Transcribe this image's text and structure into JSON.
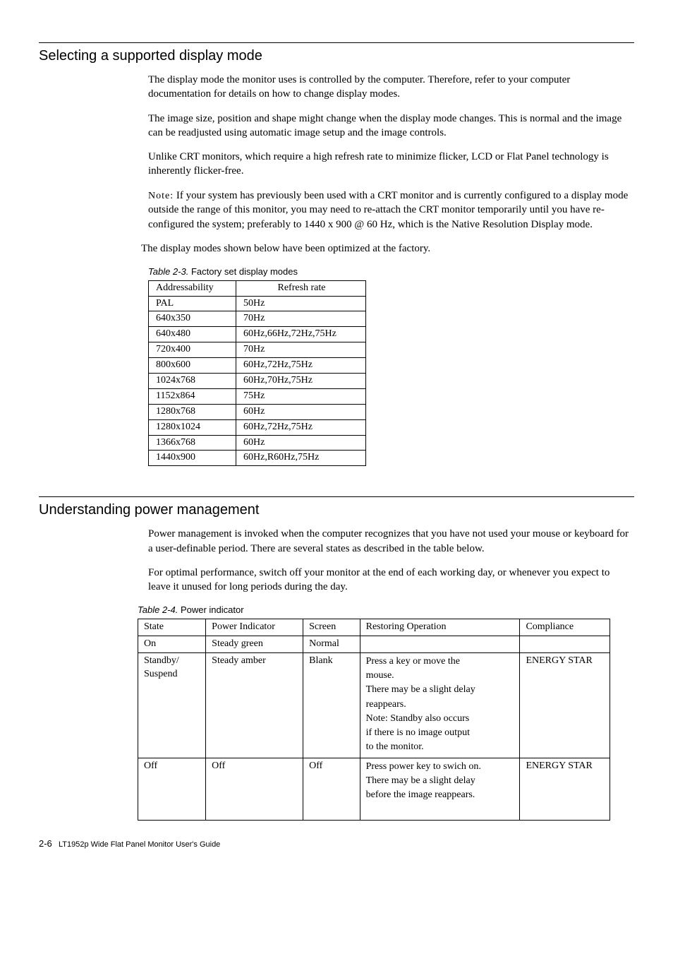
{
  "section1": {
    "heading": "Selecting a supported display mode",
    "p1": "The display mode the monitor uses is controlled by the computer. Therefore, refer to your computer documentation for details on how to change display modes.",
    "p2": "The image size, position and shape might change when the display mode changes. This is normal and the image can be readjusted using automatic image setup and the image controls.",
    "p3": "Unlike CRT monitors, which require a high refresh rate to minimize flicker, LCD or Flat Panel technology is inherently flicker-free.",
    "note_label": "Note:",
    "note_text": " If your system has previously been used with a CRT monitor and is currently configured to a display mode outside the range of this monitor, you may need to re-attach the CRT monitor temporarily until you have re-configured the system; preferably to 1440 x 900 @ 60 Hz, which is the Native Resolution Display mode.",
    "p5": "The display modes shown below have been optimized at the factory.",
    "table_caption_label": "Table 2-3.",
    "table_caption_text": " Factory set display modes",
    "table_headers": [
      "Addressability",
      "Refresh rate"
    ],
    "table_rows": [
      [
        "PAL",
        "50Hz"
      ],
      [
        "640x350",
        "70Hz"
      ],
      [
        "640x480",
        "60Hz,66Hz,72Hz,75Hz"
      ],
      [
        "720x400",
        "70Hz"
      ],
      [
        "800x600",
        "60Hz,72Hz,75Hz"
      ],
      [
        "1024x768",
        "60Hz,70Hz,75Hz"
      ],
      [
        "1152x864",
        "75Hz"
      ],
      [
        "1280x768",
        "60Hz"
      ],
      [
        "1280x1024",
        "60Hz,72Hz,75Hz"
      ],
      [
        "1366x768",
        "60Hz"
      ],
      [
        "1440x900",
        "60Hz,R60Hz,75Hz"
      ]
    ]
  },
  "section2": {
    "heading": "Understanding power management",
    "p1": "Power management is invoked when the computer recognizes that you have not used your mouse or keyboard for a user-definable period. There are several states as described in the table below.",
    "p2": "For optimal performance, switch off your monitor at the end of each working day, or whenever you expect to leave it unused for long periods during the day.",
    "table_caption_label": "Table 2-4.",
    "table_caption_text": " Power indicator",
    "table_headers": [
      "State",
      "Power Indicator",
      "Screen",
      "Restoring Operation",
      "Compliance"
    ],
    "row_on": [
      "On",
      "Steady green",
      "Normal",
      "",
      ""
    ],
    "row_standby": {
      "state1": "Standby/",
      "state2": "Suspend",
      "indicator": "Steady amber",
      "screen": "Blank",
      "restore1": "Press a key or move the",
      "restore2": "mouse.",
      "restore3": "There may be a slight delay",
      "restore4": "reappears.",
      "restore5": "Note: Standby also occurs",
      "restore6": "if there is no image output",
      "restore7": "to the monitor.",
      "compliance": "ENERGY STAR"
    },
    "row_off": {
      "state": "Off",
      "indicator": "Off",
      "screen": "Off",
      "restore1": "Press power key to swich on.",
      "restore2": "There may be a slight delay",
      "restore3": "before the image reappears.",
      "compliance": "ENERGY STAR"
    }
  },
  "footer": {
    "pagenum": "2-6",
    "title": "LT1952p Wide Flat Panel Monitor User's Guide"
  }
}
